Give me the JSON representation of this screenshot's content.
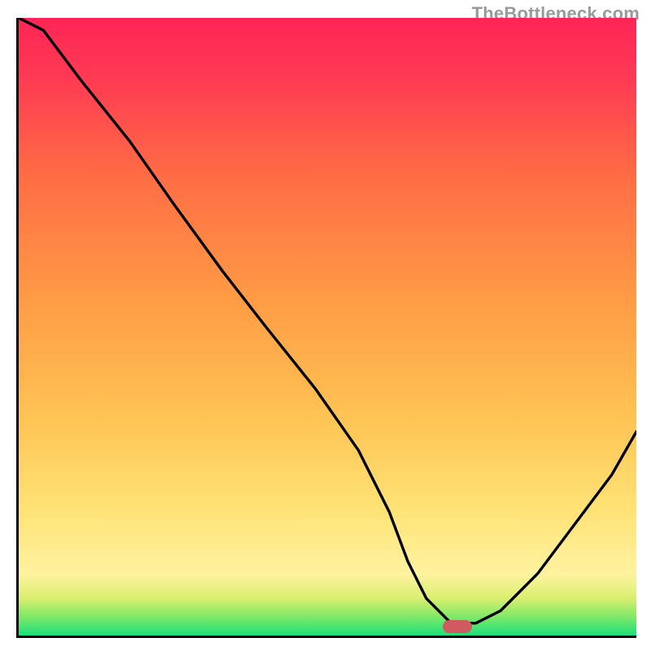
{
  "watermark": "TheBottleneck.com",
  "chart_data": {
    "type": "line",
    "title": "",
    "xlabel": "",
    "ylabel": "",
    "xlim": [
      0,
      100
    ],
    "ylim": [
      0,
      100
    ],
    "x": [
      0,
      4,
      10,
      18,
      25,
      33,
      40,
      48,
      55,
      60,
      63,
      66,
      70,
      74,
      78,
      84,
      90,
      96,
      100
    ],
    "y": [
      100,
      98,
      90,
      80,
      70,
      59,
      50,
      40,
      30,
      20,
      12,
      6,
      2,
      2,
      4,
      10,
      18,
      26,
      33
    ],
    "annotation_marker": {
      "x": 71,
      "y": 1.5
    },
    "background_gradient_stops": [
      {
        "pct": 0,
        "color": "#19e07a"
      },
      {
        "pct": 3,
        "color": "#7fe868"
      },
      {
        "pct": 6,
        "color": "#d9ef70"
      },
      {
        "pct": 10,
        "color": "#fff3a0"
      },
      {
        "pct": 20,
        "color": "#ffe377"
      },
      {
        "pct": 35,
        "color": "#ffc454"
      },
      {
        "pct": 55,
        "color": "#ff9a45"
      },
      {
        "pct": 75,
        "color": "#ff6b45"
      },
      {
        "pct": 90,
        "color": "#ff3b53"
      },
      {
        "pct": 100,
        "color": "#ff2556"
      }
    ]
  }
}
